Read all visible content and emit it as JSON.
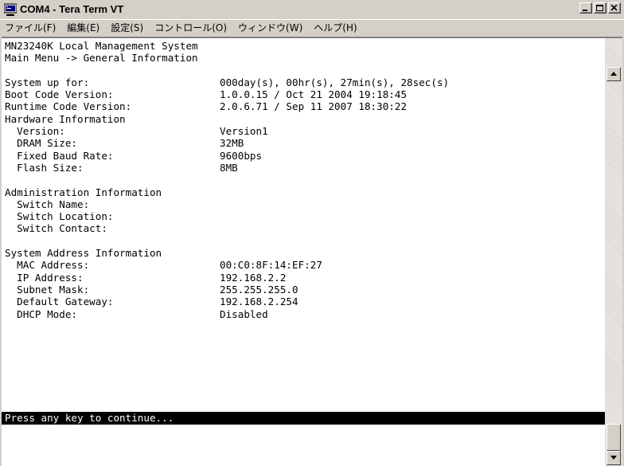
{
  "window": {
    "title": "COM4 - Tera Term VT",
    "app_icon": "tera-term-monitor-icon",
    "controls": [
      "minimize-icon",
      "maximize-icon",
      "close-icon"
    ]
  },
  "menu": [
    {
      "label": "ファイル(F)"
    },
    {
      "label": "編集(E)"
    },
    {
      "label": "設定(S)"
    },
    {
      "label": "コントロール(O)"
    },
    {
      "label": "ウィンドウ(W)"
    },
    {
      "label": "ヘルプ(H)"
    }
  ],
  "terminal": {
    "lines": [
      {
        "key": "MN23240K Local Management System",
        "value": ""
      },
      {
        "key": "Main Menu -> General Information",
        "value": ""
      },
      {
        "key": "",
        "value": ""
      },
      {
        "key": "System up for:",
        "value": "000day(s), 00hr(s), 27min(s), 28sec(s)"
      },
      {
        "key": "Boot Code Version:",
        "value": "1.0.0.15 / Oct 21 2004 19:18:45"
      },
      {
        "key": "Runtime Code Version:",
        "value": "2.0.6.71 / Sep 11 2007 18:30:22"
      },
      {
        "key": "Hardware Information",
        "value": ""
      },
      {
        "key": "  Version:",
        "value": "Version1"
      },
      {
        "key": "  DRAM Size:",
        "value": "32MB"
      },
      {
        "key": "  Fixed Baud Rate:",
        "value": "9600bps"
      },
      {
        "key": "  Flash Size:",
        "value": "8MB"
      },
      {
        "key": "",
        "value": ""
      },
      {
        "key": "Administration Information",
        "value": ""
      },
      {
        "key": "  Switch Name:",
        "value": ""
      },
      {
        "key": "  Switch Location:",
        "value": ""
      },
      {
        "key": "  Switch Contact:",
        "value": ""
      },
      {
        "key": "",
        "value": ""
      },
      {
        "key": "System Address Information",
        "value": ""
      },
      {
        "key": "  MAC Address:",
        "value": "00:C0:8F:14:EF:27"
      },
      {
        "key": "  IP Address:",
        "value": "192.168.2.2"
      },
      {
        "key": "  Subnet Mask:",
        "value": "255.255.255.0"
      },
      {
        "key": "  Default Gateway:",
        "value": "192.168.2.254"
      },
      {
        "key": "  DHCP Mode:",
        "value": "Disabled"
      }
    ],
    "status_line": "Press any key to continue..."
  },
  "scrollbar": {
    "up_icon": "scroll-up-arrow-icon",
    "down_icon": "scroll-down-arrow-icon"
  }
}
